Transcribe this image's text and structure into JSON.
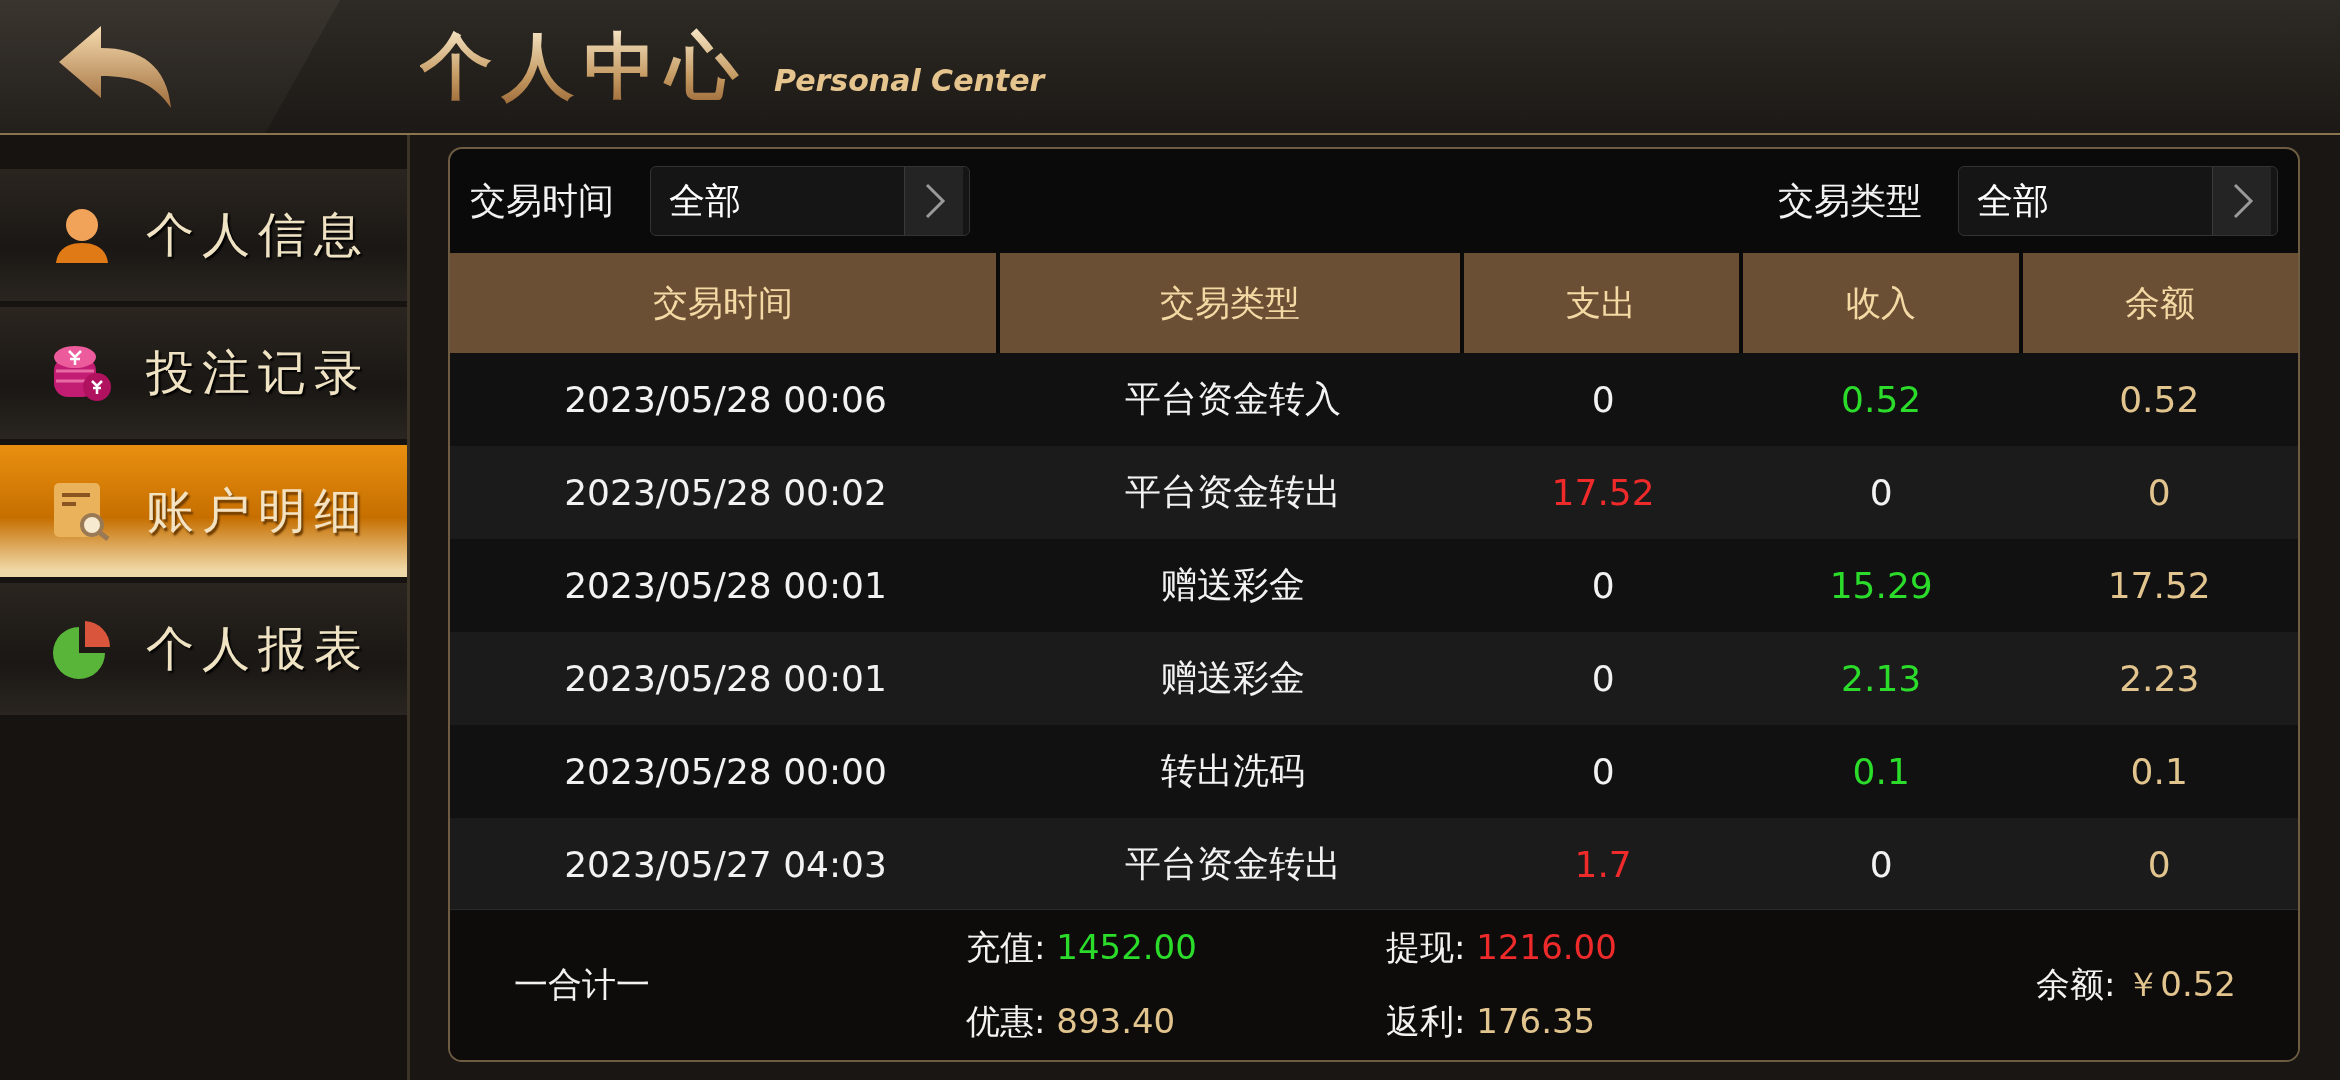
{
  "header": {
    "title": "个人中心",
    "subtitle": "Personal Center"
  },
  "sidebar": {
    "items": [
      {
        "label": "个人信息",
        "kind": "person",
        "selected": false
      },
      {
        "label": "投注记录",
        "kind": "coins",
        "selected": false
      },
      {
        "label": "账户明细",
        "kind": "ledger",
        "selected": true
      },
      {
        "label": "个人报表",
        "kind": "pie",
        "selected": false
      }
    ]
  },
  "filters": [
    {
      "label": "交易时间",
      "value": "全部"
    },
    {
      "label": "交易类型",
      "value": "全部"
    }
  ],
  "table": {
    "columns": [
      "交易时间",
      "交易类型",
      "支出",
      "收入",
      "余额"
    ],
    "rows": [
      {
        "cells": [
          {
            "text": "2023/05/28 00:06",
            "kind": "plain"
          },
          {
            "text": "平台资金转入",
            "kind": "plain"
          },
          {
            "text": "0",
            "kind": "plain"
          },
          {
            "text": "0.52",
            "kind": "income"
          },
          {
            "text": "0.52",
            "kind": "balance"
          }
        ]
      },
      {
        "cells": [
          {
            "text": "2023/05/28 00:02",
            "kind": "plain"
          },
          {
            "text": "平台资金转出",
            "kind": "plain"
          },
          {
            "text": "17.52",
            "kind": "expense"
          },
          {
            "text": "0",
            "kind": "plain"
          },
          {
            "text": "0",
            "kind": "balance"
          }
        ]
      },
      {
        "cells": [
          {
            "text": "2023/05/28 00:01",
            "kind": "plain"
          },
          {
            "text": "赠送彩金",
            "kind": "plain"
          },
          {
            "text": "0",
            "kind": "plain"
          },
          {
            "text": "15.29",
            "kind": "income"
          },
          {
            "text": "17.52",
            "kind": "balance"
          }
        ]
      },
      {
        "cells": [
          {
            "text": "2023/05/28 00:01",
            "kind": "plain"
          },
          {
            "text": "赠送彩金",
            "kind": "plain"
          },
          {
            "text": "0",
            "kind": "plain"
          },
          {
            "text": "2.13",
            "kind": "income"
          },
          {
            "text": "2.23",
            "kind": "balance"
          }
        ]
      },
      {
        "cells": [
          {
            "text": "2023/05/28 00:00",
            "kind": "plain"
          },
          {
            "text": "转出洗码",
            "kind": "plain"
          },
          {
            "text": "0",
            "kind": "plain"
          },
          {
            "text": "0.1",
            "kind": "income"
          },
          {
            "text": "0.1",
            "kind": "balance"
          }
        ]
      },
      {
        "cells": [
          {
            "text": "2023/05/27 04:03",
            "kind": "plain"
          },
          {
            "text": "平台资金转出",
            "kind": "plain"
          },
          {
            "text": "1.7",
            "kind": "expense"
          },
          {
            "text": "0",
            "kind": "plain"
          },
          {
            "text": "0",
            "kind": "balance"
          }
        ]
      }
    ]
  },
  "summary": {
    "label": "一合计一",
    "items": [
      {
        "label": "充值:",
        "value": "1452.00",
        "kind": "income"
      },
      {
        "label": "提现:",
        "value": "1216.00",
        "kind": "expense"
      },
      {
        "label": "优惠:",
        "value": "893.40",
        "kind": "balance"
      },
      {
        "label": "返利:",
        "value": "176.35",
        "kind": "balance"
      }
    ],
    "balance": {
      "label": "余额:",
      "value": "￥0.52",
      "kind": "balance"
    }
  }
}
